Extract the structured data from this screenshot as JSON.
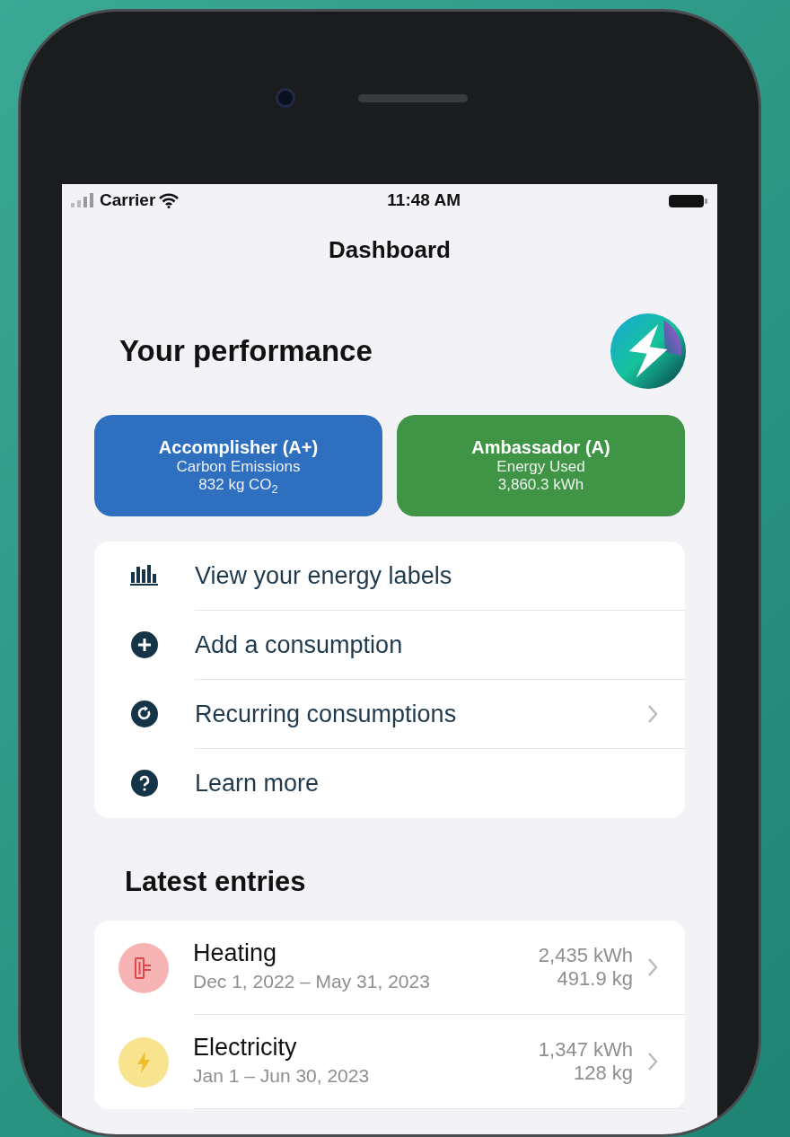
{
  "status_bar": {
    "carrier": "Carrier",
    "time": "11:48 AM"
  },
  "nav_title": "Dashboard",
  "performance": {
    "title": "Your performance",
    "badges": [
      {
        "title": "Accomplisher (A+)",
        "subtitle": "Carbon Emissions",
        "value": "832 kg CO$_{2}$",
        "color": "#2f6fc0"
      },
      {
        "title": "Ambassador (A)",
        "subtitle": "Energy Used",
        "value": "3,860.3 kWh",
        "color": "#3f9446"
      }
    ]
  },
  "menu": [
    {
      "label": "View your energy labels",
      "kind": "chart",
      "chevron": false
    },
    {
      "label": "Add a consumption",
      "kind": "plus",
      "chevron": false
    },
    {
      "label": "Recurring consumptions",
      "kind": "refresh",
      "chevron": true
    },
    {
      "label": "Learn more",
      "kind": "question",
      "chevron": false
    }
  ],
  "latest": {
    "title": "Latest entries",
    "entries": [
      {
        "kind": "heating",
        "name": "Heating",
        "dates": "Dec 1, 2022 – May 31, 2023",
        "energy": "2,435 kWh",
        "emissions": "491.9 kg",
        "color": "#f6b4b4"
      },
      {
        "kind": "electricity",
        "name": "Electricity",
        "dates": "Jan 1 – Jun 30, 2023",
        "energy": "1,347 kWh",
        "emissions": "128 kg",
        "color": "#f8e38e"
      }
    ]
  }
}
